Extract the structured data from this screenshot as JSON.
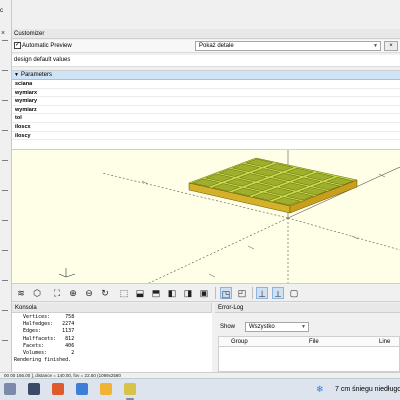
{
  "app": {
    "title_tail": "c"
  },
  "customizer": {
    "title": "Customizer",
    "close_glyph": "×",
    "auto_preview_label": "Automatic Preview",
    "auto_preview_checked": true,
    "display_mode": "Pokaż detale",
    "preset": "design default values"
  },
  "parameters": {
    "header": "Parameters",
    "items": [
      "sciana",
      "wymiarx",
      "wymiary",
      "wymiarz",
      "tol",
      "iloscx",
      "iloscy"
    ]
  },
  "console": {
    "title": "Konsola",
    "lines": [
      "   Vertices:     758",
      "   Halfedges:   2274",
      "   Edges:       1137",
      "   Halffacets:   812",
      "   Facets:       406",
      "   Volumes:        2",
      "Rendering finished."
    ]
  },
  "error_log": {
    "title": "Error-Log",
    "show_label": "Show",
    "filter_value": "Wszystko",
    "columns": [
      "Group",
      "File",
      "Line"
    ]
  },
  "statusbar": {
    "text": "00 00 166.00 ], distance = 140.00, fov = 22.50 (1099x2580"
  },
  "taskbar": {
    "weather": "7 cm śniegu niedługo"
  },
  "colors": {
    "viewport_bg": "#ffffe7",
    "model_top": "#c8d84a",
    "model_side": "#d4b12a",
    "accent": "#1a73c8"
  }
}
